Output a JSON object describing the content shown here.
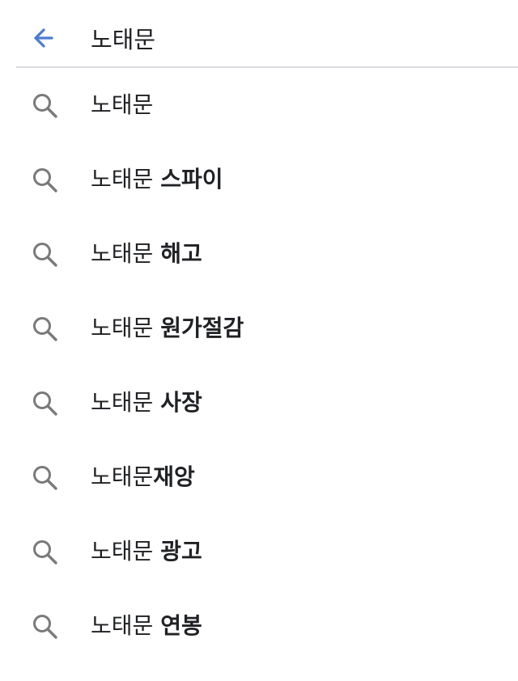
{
  "search": {
    "query": "노태문",
    "back_icon": "arrow-back-icon"
  },
  "colors": {
    "accent": "#4c7bd1",
    "icon_gray": "#7a7a7a",
    "divider": "#dadce0",
    "text": "#202124"
  },
  "suggestions": [
    {
      "prefix": "노태문",
      "suffix": ""
    },
    {
      "prefix": "노태문 ",
      "suffix": "스파이"
    },
    {
      "prefix": "노태문 ",
      "suffix": "해고"
    },
    {
      "prefix": "노태문 ",
      "suffix": "원가절감"
    },
    {
      "prefix": "노태문 ",
      "suffix": "사장"
    },
    {
      "prefix": "노태문",
      "suffix": "재앙"
    },
    {
      "prefix": "노태문 ",
      "suffix": "광고"
    },
    {
      "prefix": "노태문 ",
      "suffix": "연봉"
    }
  ],
  "suggestion_icon": "search-icon"
}
